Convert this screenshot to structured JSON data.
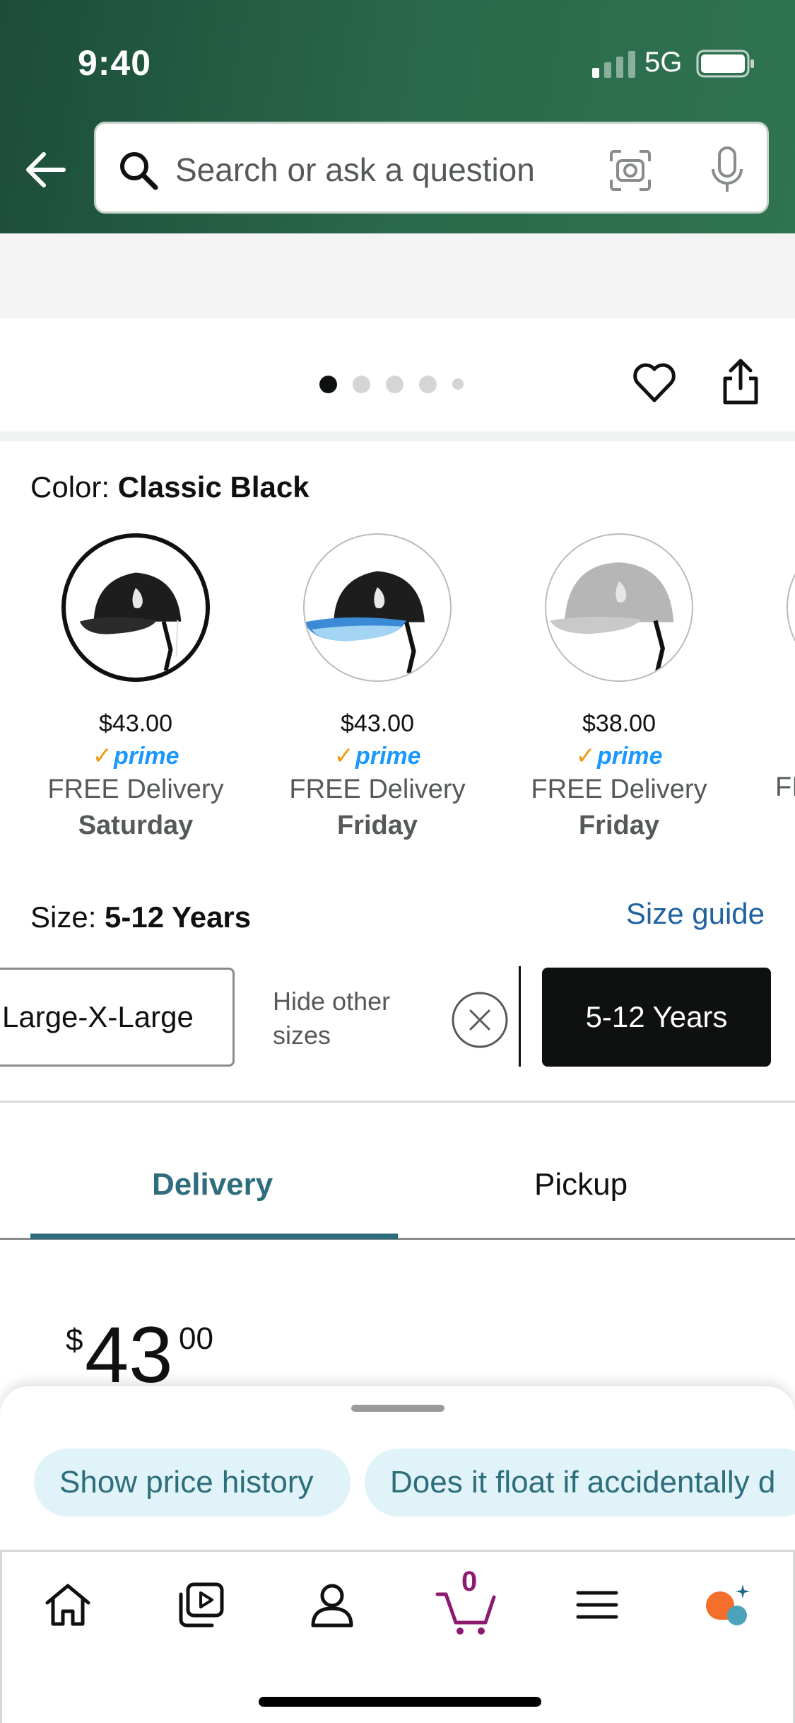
{
  "status_bar": {
    "time": "9:40",
    "network": "5G"
  },
  "search": {
    "placeholder": "Search or ask a question"
  },
  "gallery": {
    "dot_count": 5,
    "active_index": 0
  },
  "color": {
    "label": "Color:",
    "selected": "Classic Black",
    "options": [
      {
        "price": "$43.00",
        "prime": "prime",
        "delivery": "FREE Delivery",
        "day": "Saturday"
      },
      {
        "price": "$43.00",
        "prime": "prime",
        "delivery": "FREE Delivery",
        "day": "Friday"
      },
      {
        "price": "$38.00",
        "prime": "prime",
        "delivery": "FREE Delivery",
        "day": "Friday"
      }
    ],
    "partial_text": "FI"
  },
  "size": {
    "label": "Size:",
    "selected": "5-12 Years",
    "guide_link": "Size guide",
    "chip_left": "Large-X-Large",
    "hide_text_line1": "Hide other",
    "hide_text_line2": "sizes",
    "selected_chip": "5-12 Years"
  },
  "tabs": {
    "delivery": "Delivery",
    "pickup": "Pickup"
  },
  "price": {
    "symbol": "$",
    "whole": "43",
    "fraction": "00"
  },
  "suggestions": [
    "Show price history",
    "Does it float if accidentally d"
  ],
  "cart": {
    "count": "0"
  },
  "colors": {
    "header_green": "#1c4d3a",
    "accent_teal": "#2d6d7c",
    "chip_bg": "#dff3f8",
    "link_blue": "#2162a1",
    "cart_purple": "#8b1a70"
  }
}
